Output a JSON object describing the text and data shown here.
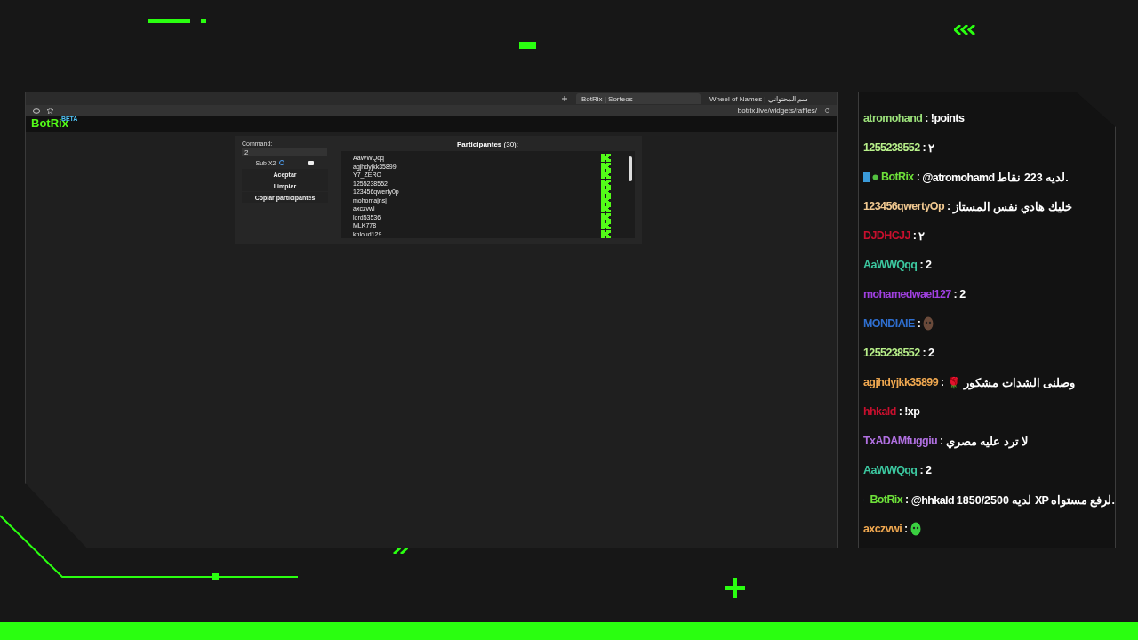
{
  "browser": {
    "tabs": [
      {
        "title": "BotRix | Sorteos",
        "selected": true
      },
      {
        "title": "Wheel of Names | سم المحتواني",
        "selected": false
      }
    ],
    "address": "botrix.live/widgets/raffles/"
  },
  "site": {
    "logo": "BotRix",
    "badge": "BETA"
  },
  "raffle": {
    "command_label": "Command:",
    "command_value": "2",
    "sub_label": "Sub X2",
    "sub_checked": false,
    "buttons": [
      "Aceptar",
      "Limpiar",
      "Copiar participantes"
    ],
    "title": "Participantes",
    "count": "(30):",
    "participants": [
      "AaWWQqq",
      "agjhdyjkk35899",
      "Y7_ZERO",
      "1255238552",
      "123456qwerty0p",
      "mohomajnsj",
      "axczvwi",
      "lord53536",
      "MLK778",
      "khloud129"
    ]
  },
  "chat_separator": ":",
  "chat": [
    {
      "kind": "text",
      "user": "atromohand",
      "color": "#9be07a",
      "text": "!points"
    },
    {
      "kind": "text",
      "user": "1255238552",
      "color": "#b8f08a",
      "text": "٢"
    },
    {
      "kind": "bot",
      "user": "BotRix",
      "color": "#6ee03a",
      "text": "@atromohamd لديه 223 نقاط."
    },
    {
      "kind": "text",
      "user": "123456qwertyOp",
      "color": "#f0c890",
      "text": "خليك هادي نفس المستاز"
    },
    {
      "kind": "text",
      "user": "DJDHCJJ",
      "color": "#c8102e",
      "text": "٢"
    },
    {
      "kind": "text",
      "user": "AaWWQqq",
      "color": "#3cc8a0",
      "text": "2"
    },
    {
      "kind": "text",
      "user": "mohamedwael127",
      "color": "#a040e0",
      "text": "2"
    },
    {
      "kind": "emote_face",
      "user": "MONDIAIE",
      "color": "#2f6fd0"
    },
    {
      "kind": "text",
      "user": "1255238552",
      "color": "#b8f08a",
      "text": "2"
    },
    {
      "kind": "text",
      "user": "agjhdyjkk35899",
      "color": "#f0a850",
      "text": "وصلنى الشدات مشكور 🌹"
    },
    {
      "kind": "text",
      "user": "hhkald",
      "color": "#c8102e",
      "text": "!xp"
    },
    {
      "kind": "text",
      "user": "TxADAMfuggiu",
      "color": "#b070e0",
      "text": "لا ترد عليه مصري"
    },
    {
      "kind": "text",
      "user": "AaWWQqq",
      "color": "#3cc8a0",
      "text": "2"
    },
    {
      "kind": "bot",
      "user": "BotRix",
      "color": "#6ee03a",
      "text": "@hhkald لديه 1850/2500 XP لرفع مستواه."
    },
    {
      "kind": "emote_blob",
      "user": "axczvwi",
      "color": "#f0a850"
    }
  ]
}
